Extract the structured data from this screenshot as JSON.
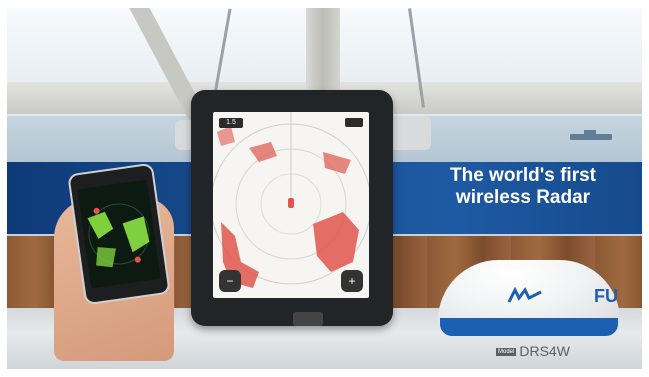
{
  "banner": {
    "line1": "The world's first",
    "line2": "wireless Radar"
  },
  "tablet": {
    "range": "1.5"
  },
  "radome": {
    "brand": "FU",
    "model_prefix": "Model",
    "model": "DRS4W"
  },
  "colors": {
    "banner_blue": "#1a4f93",
    "radar_echo": "#e0564d",
    "phone_echo": "#7ed03e",
    "brand_blue": "#1d5fb0"
  },
  "icons": [
    "zoom-out-icon",
    "zoom-in-icon"
  ]
}
